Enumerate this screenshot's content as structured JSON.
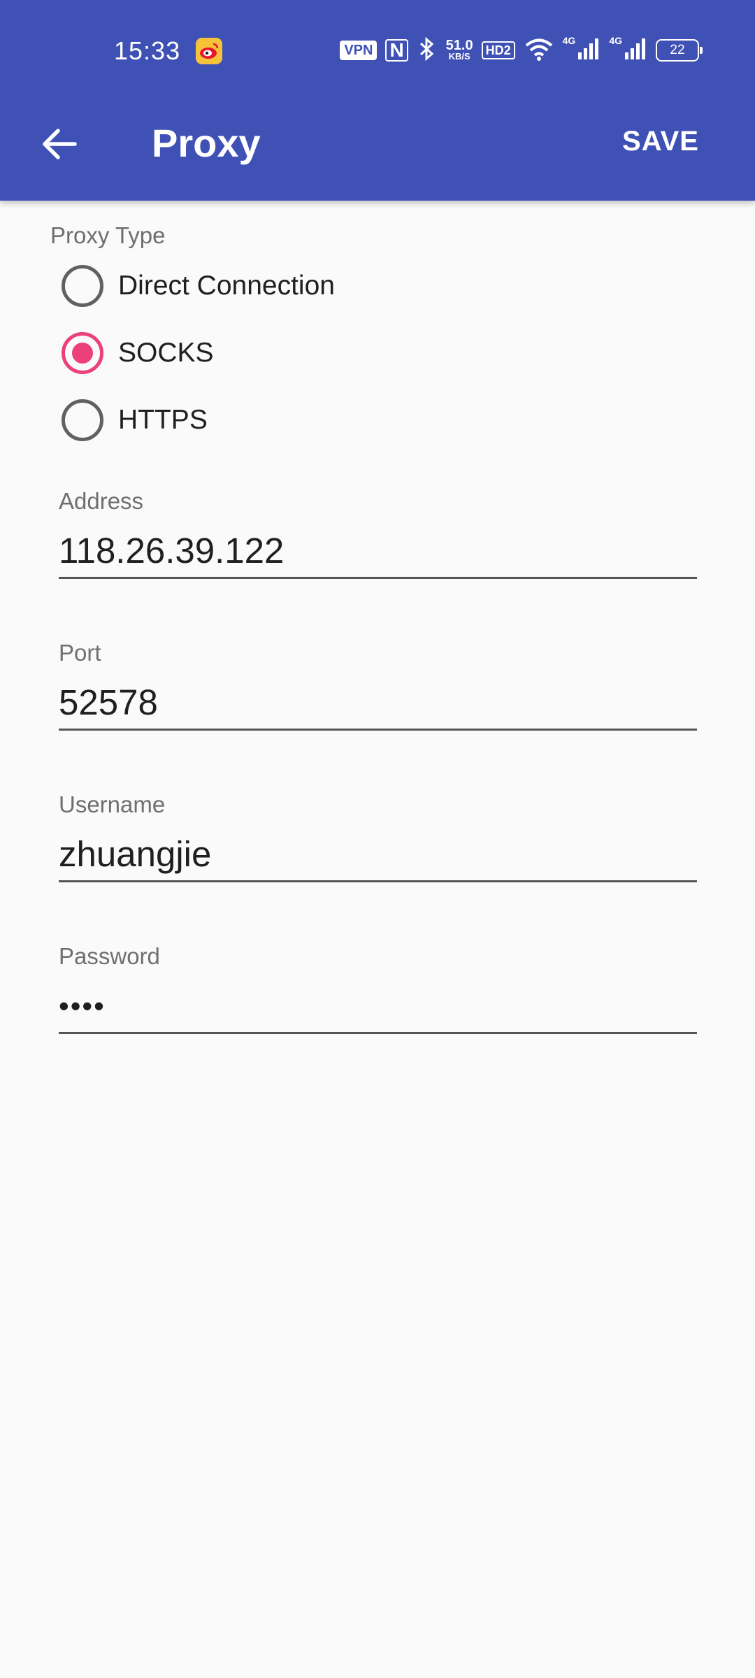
{
  "status_bar": {
    "time": "15:33",
    "vpn": "VPN",
    "nfc": "N",
    "speed_value": "51.0",
    "speed_unit": "KB/S",
    "hd": "HD2",
    "signal1_label": "4G",
    "signal2_label": "4G",
    "battery": "22",
    "icons": [
      "weibo-icon",
      "vpn-icon",
      "nfc-icon",
      "bluetooth-icon",
      "wifi-icon",
      "signal-icon",
      "battery-icon"
    ]
  },
  "app_bar": {
    "title": "Proxy",
    "save_label": "SAVE",
    "back_icon": "arrow-back-icon",
    "color": "#3f51b5"
  },
  "proxy_type": {
    "label": "Proxy Type",
    "options": [
      {
        "label": "Direct Connection",
        "checked": false
      },
      {
        "label": "SOCKS",
        "checked": true
      },
      {
        "label": "HTTPS",
        "checked": false
      }
    ],
    "accent": "#ec407a"
  },
  "fields": {
    "address": {
      "label": "Address",
      "value": "118.26.39.122"
    },
    "port": {
      "label": "Port",
      "value": "52578"
    },
    "username": {
      "label": "Username",
      "value": "zhuangjie"
    },
    "password": {
      "label": "Password",
      "value": "••••"
    }
  }
}
